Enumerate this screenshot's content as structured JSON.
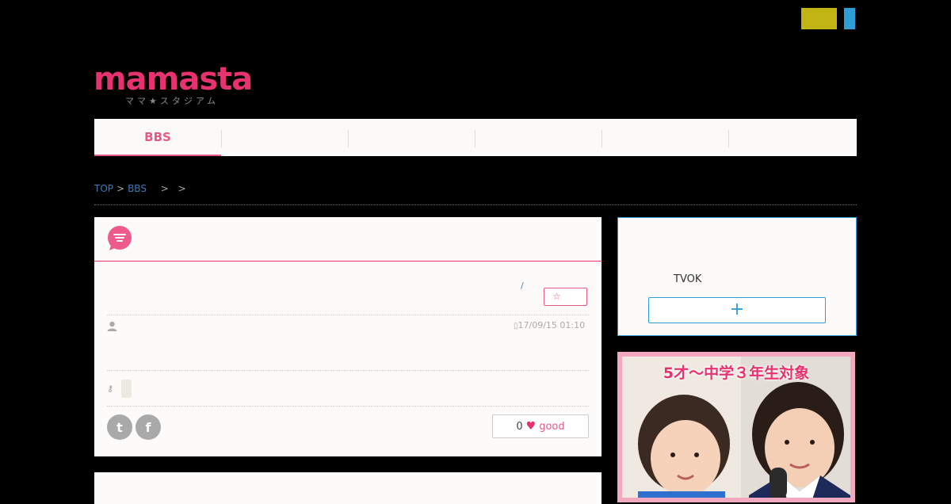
{
  "header": {
    "logo_text": "mamasta",
    "logo_sub": "ママ★スタジアム"
  },
  "nav": {
    "items": [
      {
        "label": "BBS"
      },
      {
        "label": ""
      },
      {
        "label": ""
      },
      {
        "label": ""
      },
      {
        "label": ""
      },
      {
        "label": ""
      }
    ]
  },
  "breadcrumb": {
    "home": "TOP",
    "sep1": ">",
    "bbs": "BBS",
    "sep2": ">",
    "sep3": ">"
  },
  "post": {
    "slash": "/",
    "fav_icon": "☆",
    "date": "17/09/15 01:10",
    "good_count": "0",
    "good_label": "good",
    "twitter_glyph": "t",
    "facebook_glyph": "f"
  },
  "sidebar": {
    "text": "TVOK",
    "plus": "+"
  },
  "ad": {
    "headline": "5才～中学３年生対象"
  },
  "colors": {
    "brand_pink": "#e6336f",
    "accent_blue": "#2f9ed7",
    "accent_yellow": "#c0b515"
  }
}
